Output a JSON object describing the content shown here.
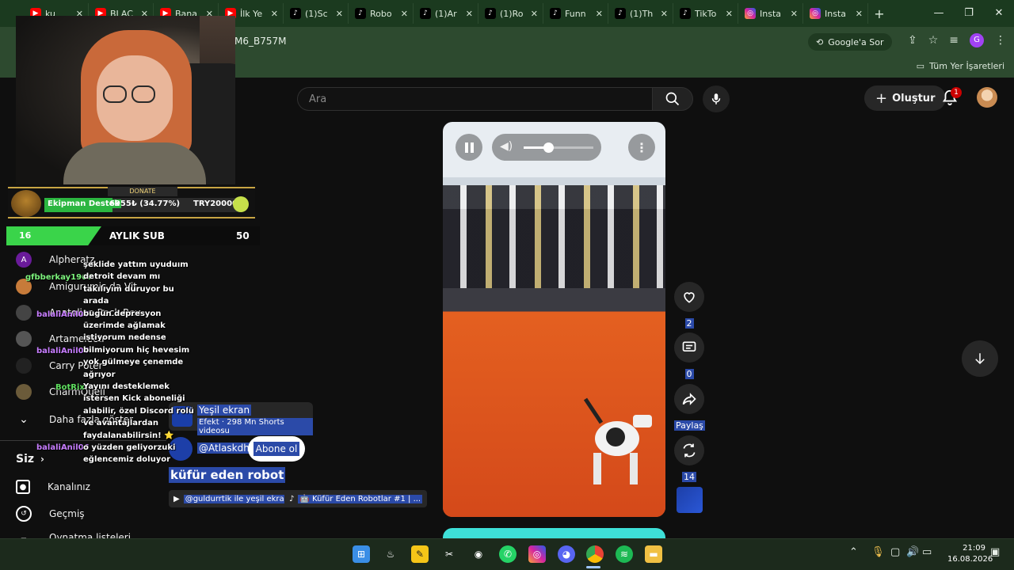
{
  "browser": {
    "tabs": [
      {
        "icon": "yt",
        "title": "ku"
      },
      {
        "icon": "yt",
        "title": "BLAC"
      },
      {
        "icon": "yt",
        "title": "Bana"
      },
      {
        "icon": "yt",
        "title": "İlk Ye"
      },
      {
        "icon": "tt",
        "title": "(1)Sc"
      },
      {
        "icon": "tt",
        "title": "Robo"
      },
      {
        "icon": "tt",
        "title": "(1)Ar"
      },
      {
        "icon": "tt",
        "title": "(1)Ro"
      },
      {
        "icon": "tt",
        "title": "Funn"
      },
      {
        "icon": "tt",
        "title": "(1)Th"
      },
      {
        "icon": "tt",
        "title": "TikTo"
      },
      {
        "icon": "ig",
        "title": "Insta"
      },
      {
        "icon": "ig",
        "title": "Insta"
      }
    ],
    "new_tab": "+",
    "url": "M6_B757M",
    "ask_google": "Google'a Sor",
    "profile_letter": "G",
    "all_bookmarks": "Tüm Yer İşaretleri"
  },
  "youtube": {
    "search_placeholder": "Ara",
    "create_label": "Oluştur",
    "notification_count": "1",
    "actions": {
      "like_count": "2",
      "comment_count": "0",
      "share_label": "Paylaş",
      "remix_count": "14"
    },
    "effect": {
      "title": "Yeşil ekran",
      "subtitle": "Efekt · 298 Mn Shorts videosu"
    },
    "channel": "@Atlaskdh",
    "subscribe_label": "Abone ol",
    "video_title": "küfür eden robot",
    "chips": [
      "@guldurrtik ile yeşil ekran",
      "🤖 Küfür Eden Robotlar #1 | ..."
    ],
    "volume_level": 0.35
  },
  "sidebar": {
    "subscriptions": [
      {
        "name": "Alpheratz",
        "letter": "A",
        "color": "#6a1b9a"
      },
      {
        "name": "Amigurumis da Vit",
        "letter": "",
        "color": "#c77b3a"
      },
      {
        "name": "Anatolian Rock Rev",
        "letter": "",
        "color": "#444444"
      },
      {
        "name": "Artamelectr",
        "letter": "",
        "color": "#555555"
      },
      {
        "name": "Carry Poter",
        "letter": "",
        "color": "#222222"
      },
      {
        "name": "CharmQuell",
        "letter": "",
        "color": "#6b5b3a"
      }
    ],
    "more_label": "Daha fazla göster",
    "you_label": "Siz",
    "channel_label": "Kanalınız",
    "history_label": "Geçmiş",
    "partial_label": "Oynatma listeleri"
  },
  "stream": {
    "donate_label": "DONATE",
    "donate_team": "Ekipman Destek",
    "donate_amount": "6955₺ (34.77%)",
    "donate_goal": "TRY20000",
    "donate_progress": 0.3477,
    "sub_count": "16",
    "sub_label": "AYLIK SUB",
    "sub_goal": "50",
    "chat_users": [
      {
        "name": "gfbberkay1907",
        "color": "#7cf27c"
      },
      {
        "name": "balaliAnil06",
        "color": "#c77dff"
      },
      {
        "name": "balaliAnil06",
        "color": "#c77dff"
      },
      {
        "name": "BotRix",
        "color": "#5fe05f"
      },
      {
        "name": "balaliAnil06",
        "color": "#c77dff"
      }
    ],
    "chat_lines": [
      "şeklide yattım uyuduım",
      "detroit devam mı",
      "takılıyım duruyor bu",
      "arada",
      "bugün depresyon",
      "üzerimde ağlamak",
      "istiyorum nedense",
      "bilmiyorum hiç hevesim",
      "yok gülmeye çenemde",
      "ağrıyor",
      "Yayını desteklemek",
      "istersen Kick aboneliği",
      "alabilir, özel Discord rolü",
      "ve avantajlardan",
      "faydalanabilirsin! ⭐",
      "o yüzden geliyorzuki",
      "eğlencemiz doluyor"
    ]
  },
  "taskbar": {
    "time": "21:09",
    "date": "16.08.2026"
  }
}
